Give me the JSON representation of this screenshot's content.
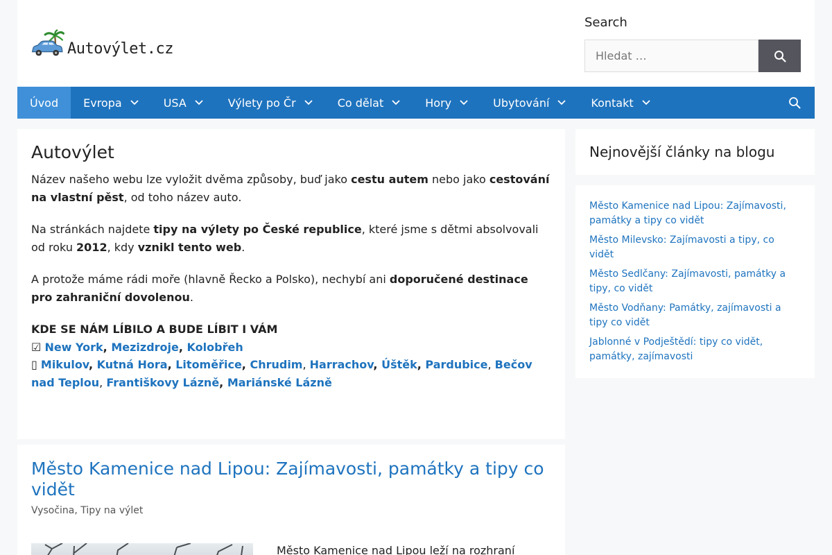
{
  "header": {
    "logo_text": "Autovýlet.cz",
    "search_label": "Search",
    "search_placeholder": "Hledat …"
  },
  "nav": {
    "items": [
      {
        "label": "Úvod",
        "active": true,
        "dropdown": false
      },
      {
        "label": "Evropa",
        "dropdown": true
      },
      {
        "label": "USA",
        "dropdown": true
      },
      {
        "label": "Výlety po Čr",
        "dropdown": true
      },
      {
        "label": "Co dělat",
        "dropdown": true
      },
      {
        "label": "Hory",
        "dropdown": true
      },
      {
        "label": "Ubytování",
        "dropdown": true
      },
      {
        "label": "Kontakt",
        "dropdown": true
      }
    ],
    "search_icon": "search-icon"
  },
  "main": {
    "title": "Autovýlet",
    "p1": {
      "a": "Název našeho webu lze vyložit dvěma způsoby, buď jako ",
      "b1": "cestu autem",
      "c": " nebo jako ",
      "b2": "cestování na vlastní pěst",
      "d": ", od toho název auto."
    },
    "p2": {
      "a": "Na stránkách najdete ",
      "b1": "tipy na výlety po České republice",
      "c": ", které jsme s dětmi absolvovali od roku ",
      "b2": "2012",
      "d": ", kdy ",
      "b3": "vznikl tento web",
      "e": "."
    },
    "p3": {
      "a": "A protože máme rádi moře (hlavně Řecko a Polsko), nechybí ani ",
      "b1": "doporučené destinace pro zahraniční dovolenou",
      "c": "."
    },
    "places_heading": "KDE SE NÁM LÍBILO A BUDE LÍBIT I VÁM",
    "row1_prefix": "☑ ",
    "row1": [
      "New York",
      "Mezizdroje",
      "Kolobřeh"
    ],
    "row2_prefix": "▯ ",
    "row2": [
      "Mikulov",
      "Kutná Hora",
      "Litoměřice",
      "Chrudim",
      "Harrachov",
      "Úštěk",
      "Pardubice",
      "Bečov nad Teplou",
      "Františkovy Lázně",
      "Mariánské Lázně"
    ]
  },
  "post": {
    "title": "Město Kamenice nad Lipou: Zajímavosti, památky a tipy co vidět",
    "categories": [
      "Vysočina",
      "Tipy na výlet"
    ],
    "excerpt": "Město Kamenice nad Lipou leží na rozhraní"
  },
  "sidebar": {
    "title": "Nejnovější články na blogu",
    "links": [
      "Město Kamenice nad Lipou: Zajímavosti, památky a tipy co vidět",
      "Město Milevsko: Zajímavosti a tipy, co vidět",
      "Město Sedlčany: Zajímavosti, památky a tipy, co vidět",
      "Město Vodňany: Památky, zajímavosti a tipy co vidět",
      "Jablonné v Podještědí: tipy co vidět, památky, zajímavosti"
    ]
  },
  "colors": {
    "accent": "#1e73be",
    "nav_active": "#3f90d9",
    "search_button": "#55555e",
    "background": "#f7f8f9"
  }
}
